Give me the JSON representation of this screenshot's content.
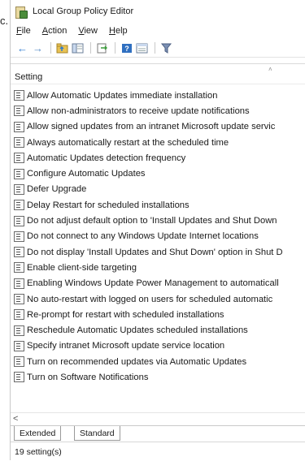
{
  "background": {
    "left_text": "c."
  },
  "window": {
    "title": "Local Group Policy Editor",
    "icon": "policy-editor-icon"
  },
  "menu": [
    {
      "underline": "F",
      "rest": "ile"
    },
    {
      "underline": "A",
      "rest": "ction"
    },
    {
      "underline": "V",
      "rest": "iew"
    },
    {
      "underline": "H",
      "rest": "elp"
    }
  ],
  "toolbar": {
    "icons": [
      "back-arrow-icon",
      "forward-arrow-icon",
      "up-folder-icon",
      "show-hide-tree-icon",
      "export-list-icon",
      "help-icon",
      "properties-icon",
      "filter-icon"
    ]
  },
  "list": {
    "column_header": "Setting",
    "rows": [
      "Allow Automatic Updates immediate installation",
      "Allow non-administrators to receive update notifications",
      "Allow signed updates from an intranet Microsoft update servic",
      "Always automatically restart at the scheduled time",
      "Automatic Updates detection frequency",
      "Configure Automatic Updates",
      "Defer Upgrade",
      "Delay Restart for scheduled installations",
      "Do not adjust default option to 'Install Updates and Shut Down",
      "Do not connect to any Windows Update Internet locations",
      "Do not display 'Install Updates and Shut Down' option in Shut D",
      "Enable client-side targeting",
      "Enabling Windows Update Power Management to automaticall",
      "No auto-restart with logged on users for scheduled automatic",
      "Re-prompt for restart with scheduled installations",
      "Reschedule Automatic Updates scheduled installations",
      "Specify intranet Microsoft update service location",
      "Turn on recommended updates via Automatic Updates",
      "Turn on Software Notifications"
    ]
  },
  "scroll": {
    "left_arrow": "<"
  },
  "tabs": {
    "extended": "Extended",
    "standard": "Standard"
  },
  "status": {
    "text": "19 setting(s)"
  }
}
